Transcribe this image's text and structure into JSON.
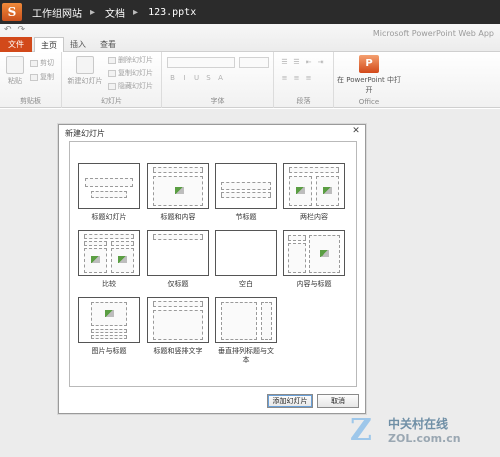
{
  "titlebar": {
    "breadcrumb": [
      "工作组网站",
      "文档",
      "123.pptx"
    ]
  },
  "ribbon": {
    "tabs": {
      "file": "文件",
      "home": "主页",
      "insert": "插入",
      "view": "查看"
    },
    "app_name": "Microsoft PowerPoint Web App",
    "clipboard": {
      "paste": "粘贴",
      "cut": "剪切",
      "copy": "复制",
      "label": "剪贴板"
    },
    "slides": {
      "new_slide": "新建幻灯片",
      "delete": "删除幻灯片",
      "duplicate": "复制幻灯片",
      "hide": "隐藏幻灯片",
      "label": "幻灯片"
    },
    "font": {
      "label": "字体"
    },
    "paragraph": {
      "label": "段落"
    },
    "office": {
      "open_in": "在 PowerPoint 中打开",
      "label": "Office"
    }
  },
  "dialog": {
    "title": "新建幻灯片",
    "layouts": [
      "标题幻灯片",
      "标题和内容",
      "节标题",
      "两栏内容",
      "比较",
      "仅标题",
      "空白",
      "内容与标题",
      "图片与标题",
      "标题和竖排文字",
      "垂直排列标题与文本"
    ],
    "add_button": "添加幻灯片",
    "cancel_button": "取消"
  },
  "watermark": {
    "cn": "中关村在线",
    "en": "ZOL.com.cn"
  }
}
